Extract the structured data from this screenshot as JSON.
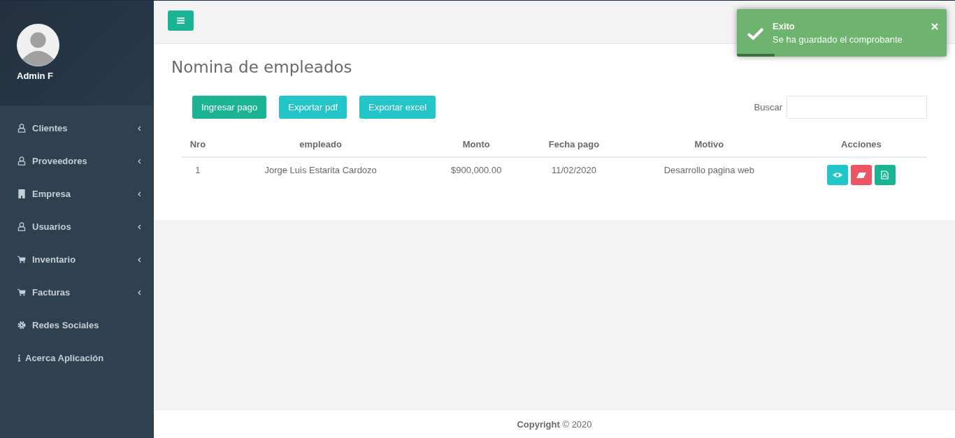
{
  "sidebar": {
    "user": {
      "name": "Admin F"
    },
    "items": [
      {
        "label": "Clientes",
        "kind": "user",
        "has_submenu": true
      },
      {
        "label": "Proveedores",
        "kind": "user",
        "has_submenu": true
      },
      {
        "label": "Empresa",
        "kind": "building",
        "has_submenu": true
      },
      {
        "label": "Usuarios",
        "kind": "user",
        "has_submenu": true
      },
      {
        "label": "Inventario",
        "kind": "cart",
        "has_submenu": true
      },
      {
        "label": "Facturas",
        "kind": "cart",
        "has_submenu": true
      },
      {
        "label": "Redes Sociales",
        "kind": "gear",
        "has_submenu": false
      },
      {
        "label": "Acerca Aplicación",
        "kind": "info",
        "has_submenu": false
      }
    ]
  },
  "page_title": "Nomina de empleados",
  "buttons": [
    {
      "label": "Ingresar pago",
      "kind": "primary"
    },
    {
      "label": "Exportar pdf",
      "kind": "info"
    },
    {
      "label": "Exportar excel",
      "kind": "info"
    }
  ],
  "search": {
    "label": "Buscar"
  },
  "table": {
    "columns": [
      "Nro",
      "empleado",
      "Monto",
      "Fecha pago",
      "Motivo",
      "Acciones"
    ],
    "rows": [
      {
        "cells": [
          "1",
          "Jorge Luis Estarita Cardozo",
          "$900,000.00",
          "11/02/2020",
          "Desarrollo pagina web"
        ],
        "actions": [
          {
            "kind": "view"
          },
          {
            "kind": "erase"
          },
          {
            "kind": "pdf"
          }
        ]
      }
    ]
  },
  "footer": {
    "text": "**Copyright** © 2020"
  },
  "toast": {
    "title": "Exito",
    "message": "Se ha guardado el comprobante",
    "level": 0.18
  }
}
